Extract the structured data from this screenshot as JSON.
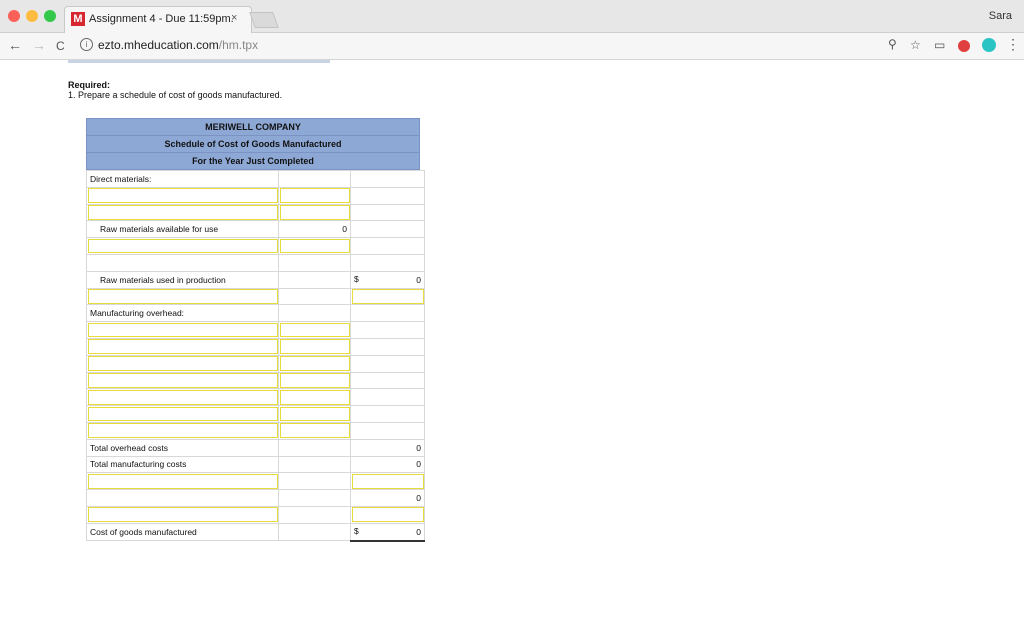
{
  "browser": {
    "tab_title": "Assignment 4 - Due 11:59pm.",
    "tab_close": "×",
    "user": "Sara",
    "url_host": "ezto.mheducation.com",
    "url_path": "/hm.tpx",
    "back_glyph": "←",
    "forward_glyph": "→",
    "reload_glyph": "C",
    "zoom_glyph": "⚲",
    "star_glyph": "☆",
    "cast_glyph": "▭",
    "menu_glyph": "⋮",
    "tab_logo": "M"
  },
  "required": {
    "heading": "Required:",
    "item": "1.  Prepare a schedule of cost of goods manufactured."
  },
  "schedule": {
    "company": "MERIWELL COMPANY",
    "title": "Schedule of Cost of Goods Manufactured",
    "period": "For the Year Just Completed",
    "direct_materials_label": "Direct materials:",
    "raw_available_label": "Raw materials available for use",
    "raw_available_value": "0",
    "raw_used_label": "Raw materials used in production",
    "raw_used_dollar": "$",
    "raw_used_value": "0",
    "mfg_overhead_label": "Manufacturing overhead:",
    "total_overhead_label": "Total overhead costs",
    "total_overhead_value": "0",
    "total_mfg_label": "Total manufacturing costs",
    "total_mfg_value": "0",
    "subtotal_value": "0",
    "cogm_label": "Cost of goods manufactured",
    "cogm_dollar": "$",
    "cogm_value": "0"
  },
  "colors": {
    "header_fill": "#8ea8d6",
    "input_outline": "#e8dc3a"
  }
}
